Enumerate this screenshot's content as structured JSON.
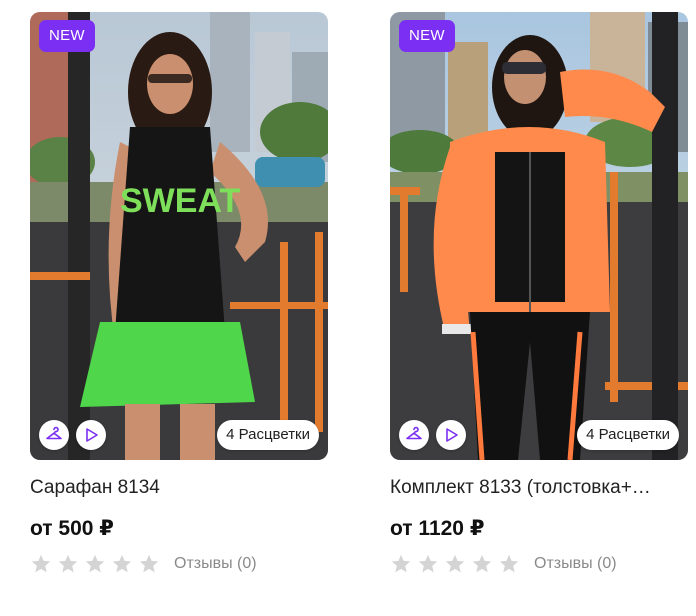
{
  "products": [
    {
      "badge": "NEW",
      "colors_label": "4 Расцветки",
      "title": "Сарафан 8134",
      "price": "от 500 ₽",
      "rating": 0,
      "reviews": "Отзывы (0)"
    },
    {
      "badge": "NEW",
      "colors_label": "4 Расцветки",
      "title": "Комплект 8133 (толстовка+…",
      "price": "от 1120 ₽",
      "rating": 0,
      "reviews": "Отзывы (0)"
    }
  ],
  "colors": {
    "badge_bg": "#7b2ff2",
    "icon_accent": "#7b2ff2",
    "star_empty": "#d4d4d4"
  },
  "icons": {
    "hanger": "hanger-icon",
    "play": "play-icon",
    "star": "star-icon"
  }
}
